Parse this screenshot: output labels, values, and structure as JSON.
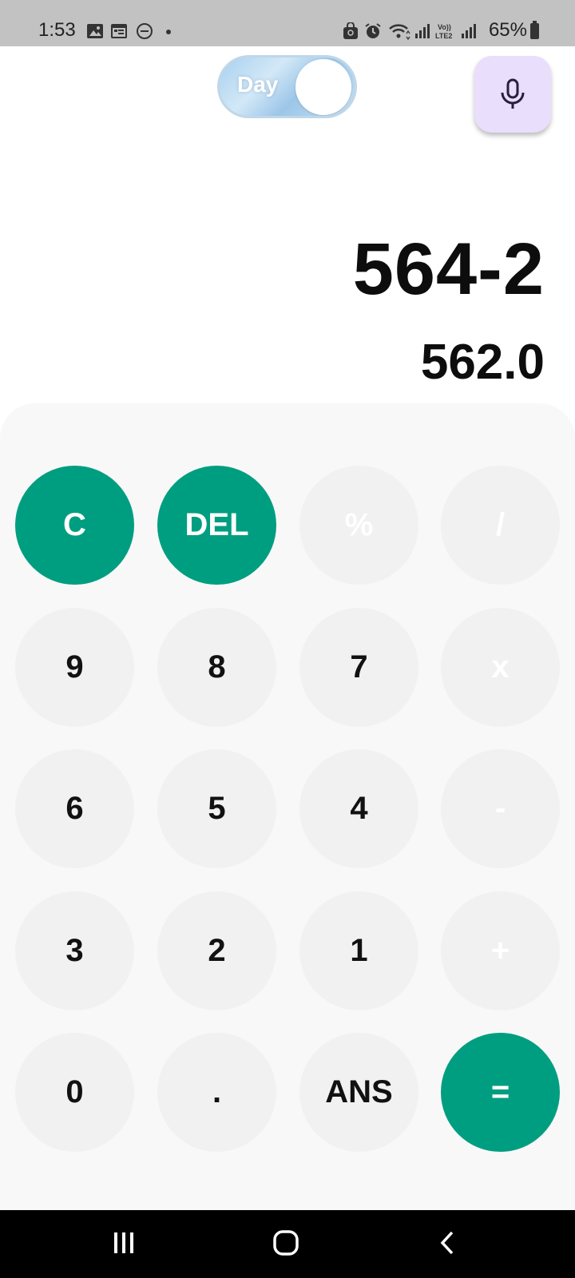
{
  "status_bar": {
    "time": "1:53",
    "right_text": "65%",
    "icons": [
      "image-icon",
      "calendar-icon",
      "dnd-icon",
      "dot-icon",
      "bag-icon",
      "alarm-icon",
      "wifi-icon",
      "signal-icon",
      "volte-lte2-icon",
      "signal-icon",
      "battery-icon"
    ]
  },
  "toggle": {
    "label": "Day"
  },
  "display": {
    "expression": "564-2",
    "result": "562.0"
  },
  "keys": {
    "clear": "C",
    "delete": "DEL",
    "percent": "%",
    "divide": "/",
    "nine": "9",
    "eight": "8",
    "seven": "7",
    "multiply": "x",
    "six": "6",
    "five": "5",
    "four": "4",
    "minus": "-",
    "three": "3",
    "two": "2",
    "one": "1",
    "plus": "+",
    "zero": "0",
    "dot": ".",
    "ans": "ANS",
    "equals": "="
  },
  "colors": {
    "accent": "#009e80",
    "key_bg": "#f1f1f1",
    "keypad_bg": "#f8f8f8",
    "mic_bg": "#e9defc"
  }
}
